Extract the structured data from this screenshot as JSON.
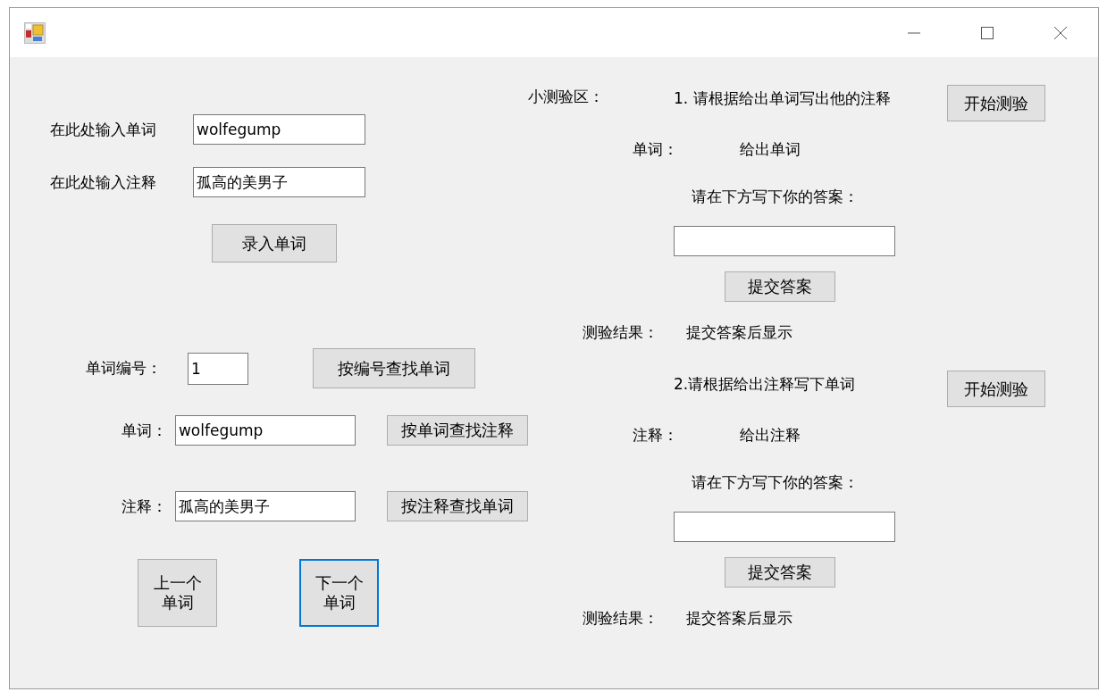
{
  "entry": {
    "word_label": "在此处输入单词",
    "word_value": "wolfegump",
    "note_label": "在此处输入注释",
    "note_value": "孤高的美男子",
    "submit": "录入单词"
  },
  "lookup": {
    "number_label": "单词编号：",
    "number_value": "1",
    "find_by_number": "按编号查找单词",
    "word_label": "单词：",
    "word_value": "wolfegump",
    "find_by_word": "按单词查找注释",
    "note_label": "注释：",
    "note_value": "孤高的美男子",
    "find_by_note": "按注释查找单词"
  },
  "navigation": [
    {
      "label": "上一个单词",
      "focused": false
    },
    {
      "label": "下一个单词",
      "focused": true
    }
  ],
  "quiz": {
    "title": "小测验区：",
    "sections": [
      {
        "prompt": "1. 请根据给出单词写出他的注释",
        "start": "开始测验",
        "given_label": "单词：",
        "given_value": "给出单词",
        "answer_prompt": "请在下方写下你的答案：",
        "submit": "提交答案",
        "result_label": "测验结果：",
        "result_value": "提交答案后显示"
      },
      {
        "prompt": "2.请根据给出注释写下单词",
        "start": "开始测验",
        "given_label": "注释：",
        "given_value": "给出注释",
        "answer_prompt": "请在下方写下你的答案：",
        "submit": "提交答案",
        "result_label": "测验结果：",
        "result_value": "提交答案后显示"
      }
    ]
  }
}
